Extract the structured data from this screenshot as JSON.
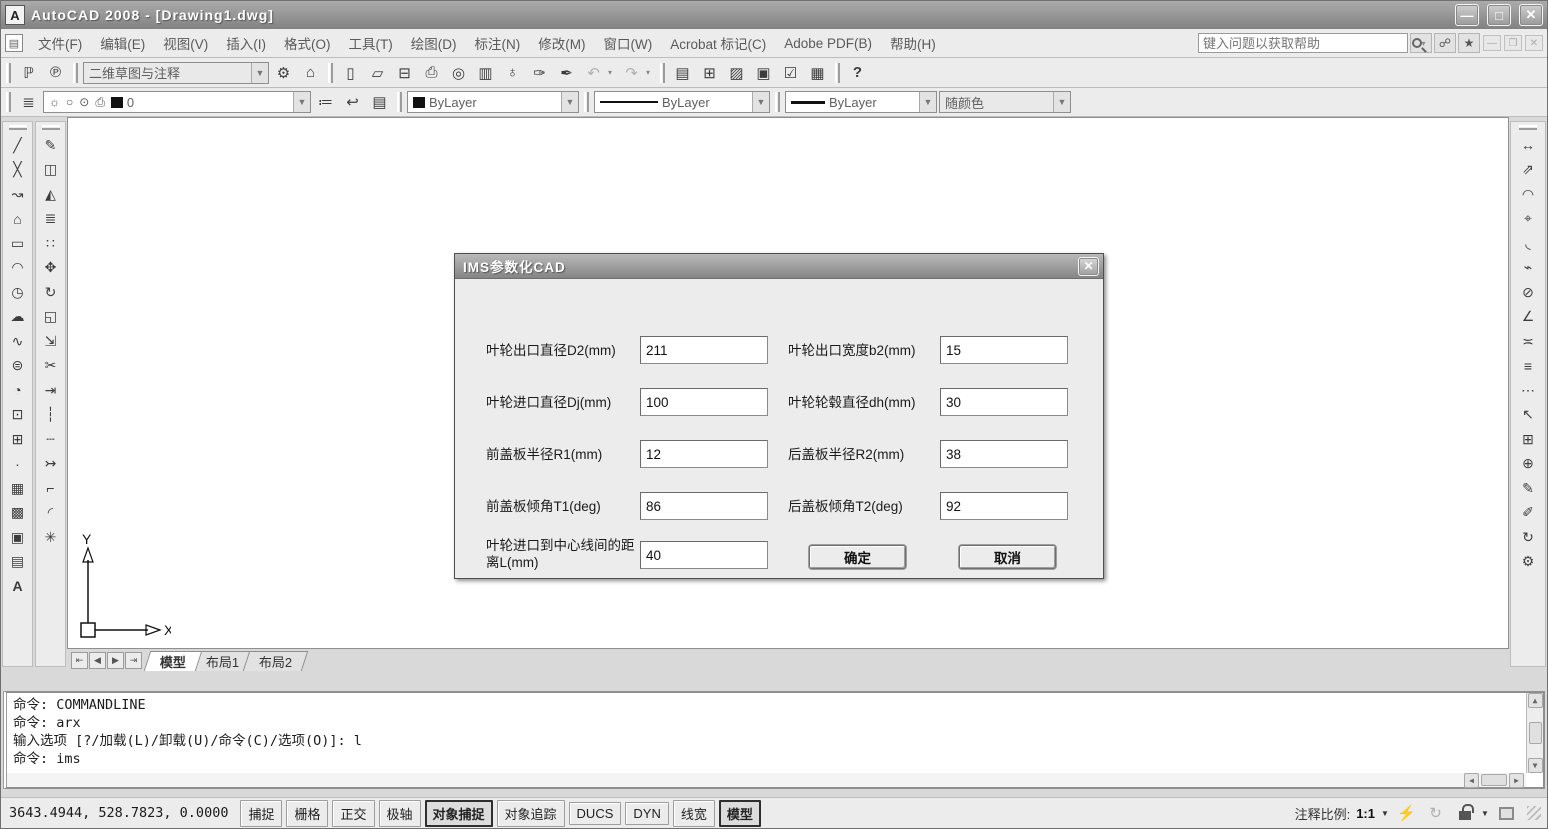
{
  "window": {
    "title": "AutoCAD 2008 - [Drawing1.dwg]",
    "controls": {
      "minimize": "—",
      "maximize": "□",
      "close": "✕"
    }
  },
  "menu": {
    "items": [
      "文件(F)",
      "编辑(E)",
      "视图(V)",
      "插入(I)",
      "格式(O)",
      "工具(T)",
      "绘图(D)",
      "标注(N)",
      "修改(M)",
      "窗口(W)",
      "Acrobat 标记(C)",
      "Adobe PDF(B)",
      "帮助(H)"
    ],
    "help_placeholder": "键入问题以获取帮助",
    "child_controls": {
      "minimize": "—",
      "restore": "❐",
      "close": "✕"
    }
  },
  "workspace_bar": {
    "pdf_items": [
      {
        "name": "convert-to-pdf",
        "glyph": "ℙ"
      },
      {
        "name": "convert-to-pdf-and-email",
        "glyph": "℗"
      }
    ],
    "workspace_value": "二维草图与注释",
    "workspace_icons": [
      {
        "name": "workspace-settings",
        "glyph": "⚙"
      },
      {
        "name": "my-workspace",
        "glyph": "⌂"
      }
    ]
  },
  "standard_toolbar": {
    "items": [
      {
        "name": "new-file",
        "glyph": "▯"
      },
      {
        "name": "open-file",
        "glyph": "▱"
      },
      {
        "name": "save",
        "glyph": "⊟"
      },
      {
        "name": "plot",
        "glyph": "⎙"
      },
      {
        "name": "plot-preview",
        "glyph": "◎"
      },
      {
        "name": "publish",
        "glyph": "▥"
      },
      {
        "name": "3d-dwf",
        "glyph": "♁"
      },
      {
        "name": "match-properties",
        "glyph": "✑"
      },
      {
        "name": "block-editor",
        "glyph": "✒"
      },
      {
        "name": "undo",
        "glyph": "↶"
      },
      {
        "name": "redo",
        "glyph": "↷"
      },
      {
        "name": "properties",
        "glyph": "▤"
      },
      {
        "name": "design-center",
        "glyph": "⊞"
      },
      {
        "name": "tool-palettes",
        "glyph": "▨"
      },
      {
        "name": "sheet-set-manager",
        "glyph": "▣"
      },
      {
        "name": "markup-set-manager",
        "glyph": "☑"
      },
      {
        "name": "quick-calc",
        "glyph": "▦"
      },
      {
        "name": "help",
        "glyph": "?"
      }
    ]
  },
  "layer_bar": {
    "layers_manager_glyph": "≣",
    "layer_row": {
      "bulb": "☼",
      "freeze": "○",
      "lock": "⊙",
      "plot": "⎙",
      "name": "0"
    },
    "buttons": [
      {
        "name": "make-object-layer-current",
        "glyph": "≔"
      },
      {
        "name": "layer-previous",
        "glyph": "↩"
      },
      {
        "name": "layer-states-manager",
        "glyph": "▤"
      }
    ],
    "color_value": "ByLayer",
    "linetype_value": "ByLayer",
    "lineweight_value": "ByLayer",
    "plotstyle_value": "随颜色"
  },
  "draw_toolbar": {
    "items": [
      {
        "name": "line",
        "glyph": "╱"
      },
      {
        "name": "construction-line",
        "glyph": "╳"
      },
      {
        "name": "polyline",
        "glyph": "↝"
      },
      {
        "name": "polygon",
        "glyph": "⌂"
      },
      {
        "name": "rectangle",
        "glyph": "▭"
      },
      {
        "name": "arc",
        "glyph": "◠"
      },
      {
        "name": "circle",
        "glyph": "◷"
      },
      {
        "name": "revision-cloud",
        "glyph": "☁"
      },
      {
        "name": "spline",
        "glyph": "∿"
      },
      {
        "name": "ellipse",
        "glyph": "⊜"
      },
      {
        "name": "ellipse-arc",
        "glyph": "◔"
      },
      {
        "name": "insert-block",
        "glyph": "⊡"
      },
      {
        "name": "make-block",
        "glyph": "⊞"
      },
      {
        "name": "point",
        "glyph": "·"
      },
      {
        "name": "hatch",
        "glyph": "▦"
      },
      {
        "name": "gradient",
        "glyph": "▩"
      },
      {
        "name": "region",
        "glyph": "▣"
      },
      {
        "name": "table",
        "glyph": "▤"
      },
      {
        "name": "multiline-text",
        "glyph": "A"
      }
    ]
  },
  "modify_toolbar": {
    "items": [
      {
        "name": "erase",
        "glyph": "✎"
      },
      {
        "name": "copy",
        "glyph": "◫"
      },
      {
        "name": "mirror",
        "glyph": "◭"
      },
      {
        "name": "offset",
        "glyph": "≣"
      },
      {
        "name": "array",
        "glyph": "∷"
      },
      {
        "name": "move",
        "glyph": "✥"
      },
      {
        "name": "rotate",
        "glyph": "↻"
      },
      {
        "name": "scale",
        "glyph": "◱"
      },
      {
        "name": "stretch",
        "glyph": "⇲"
      },
      {
        "name": "trim",
        "glyph": "✂"
      },
      {
        "name": "extend",
        "glyph": "⇥"
      },
      {
        "name": "break-at-point",
        "glyph": "┆"
      },
      {
        "name": "break",
        "glyph": "┄"
      },
      {
        "name": "join",
        "glyph": "↣"
      },
      {
        "name": "chamfer",
        "glyph": "⌐"
      },
      {
        "name": "fillet",
        "glyph": "◜"
      },
      {
        "name": "explode",
        "glyph": "✳"
      }
    ]
  },
  "dimension_toolbar": {
    "items": [
      {
        "name": "linear-dimension",
        "glyph": "↔"
      },
      {
        "name": "aligned-dimension",
        "glyph": "⇗"
      },
      {
        "name": "arc-length-dimension",
        "glyph": "◠"
      },
      {
        "name": "ordinate-dimension",
        "glyph": "⌖"
      },
      {
        "name": "radius-dimension",
        "glyph": "◟"
      },
      {
        "name": "jogged-dimension",
        "glyph": "⌁"
      },
      {
        "name": "diameter-dimension",
        "glyph": "⊘"
      },
      {
        "name": "angular-dimension",
        "glyph": "∠"
      },
      {
        "name": "quick-dimension",
        "glyph": "≍"
      },
      {
        "name": "baseline-dimension",
        "glyph": "≡"
      },
      {
        "name": "continue-dimension",
        "glyph": "⋯"
      },
      {
        "name": "quick-leader",
        "glyph": "↖"
      },
      {
        "name": "tolerance",
        "glyph": "⊞"
      },
      {
        "name": "center-mark",
        "glyph": "⊕"
      },
      {
        "name": "dimension-edit",
        "glyph": "✎"
      },
      {
        "name": "dimension-text-edit",
        "glyph": "✐"
      },
      {
        "name": "dimension-update",
        "glyph": "↻"
      },
      {
        "name": "dimension-style",
        "glyph": "⚙"
      }
    ]
  },
  "layout_tabs": {
    "nav": [
      {
        "name": "first",
        "glyph": "⇤"
      },
      {
        "name": "prev",
        "glyph": "◀"
      },
      {
        "name": "next",
        "glyph": "▶"
      },
      {
        "name": "last",
        "glyph": "⇥"
      }
    ],
    "tabs": [
      {
        "label": "模型",
        "active": true
      },
      {
        "label": "布局1",
        "active": false
      },
      {
        "label": "布局2",
        "active": false
      }
    ]
  },
  "ucs": {
    "x_label": "X",
    "y_label": "Y"
  },
  "dialog": {
    "title": "IMS参数化CAD",
    "close_glyph": "✕",
    "rows": [
      {
        "label_left": "叶轮出口直径D2(mm)",
        "value_left": "211",
        "label_right": "叶轮出口宽度b2(mm)",
        "value_right": "15"
      },
      {
        "label_left": "叶轮进口直径Dj(mm)",
        "value_left": "100",
        "label_right": "叶轮轮毂直径dh(mm)",
        "value_right": "30"
      },
      {
        "label_left": "前盖板半径R1(mm)",
        "value_left": "12",
        "label_right": "后盖板半径R2(mm)",
        "value_right": "38"
      },
      {
        "label_left": "前盖板倾角T1(deg)",
        "value_left": "86",
        "label_right": "后盖板倾角T2(deg)",
        "value_right": "92"
      },
      {
        "label_left": "叶轮进口到中心线间的距离L(mm)",
        "value_left": "40"
      }
    ],
    "ok_label": "确定",
    "cancel_label": "取消"
  },
  "command": {
    "lines": [
      "命令: COMMANDLINE",
      "命令: arx",
      "输入选项 [?/加载(L)/卸载(U)/命令(C)/选项(O)]: l",
      "命令: ims"
    ]
  },
  "status": {
    "coords": "3643.4944, 528.7823, 0.0000",
    "toggles": [
      {
        "label": "捕捉",
        "active": false
      },
      {
        "label": "栅格",
        "active": false
      },
      {
        "label": "正交",
        "active": false
      },
      {
        "label": "极轴",
        "active": false
      },
      {
        "label": "对象捕捉",
        "active": true
      },
      {
        "label": "对象追踪",
        "active": false
      },
      {
        "label": "DUCS",
        "active": false
      },
      {
        "label": "DYN",
        "active": false
      },
      {
        "label": "线宽",
        "active": false
      },
      {
        "label": "模型",
        "active": true
      }
    ],
    "annotation_scale_label": "注释比例:",
    "annotation_scale_value": "1:1",
    "dropdown_glyph": "▼"
  },
  "scroll_glyphs": {
    "up": "▲",
    "down": "▼",
    "left": "◀",
    "right": "▶"
  },
  "colors": {
    "chrome": "#ececec",
    "titlebar": "#8f8f8f",
    "canvas": "#ffffff",
    "text": "#1a1a1a",
    "swatch": "#111111"
  }
}
